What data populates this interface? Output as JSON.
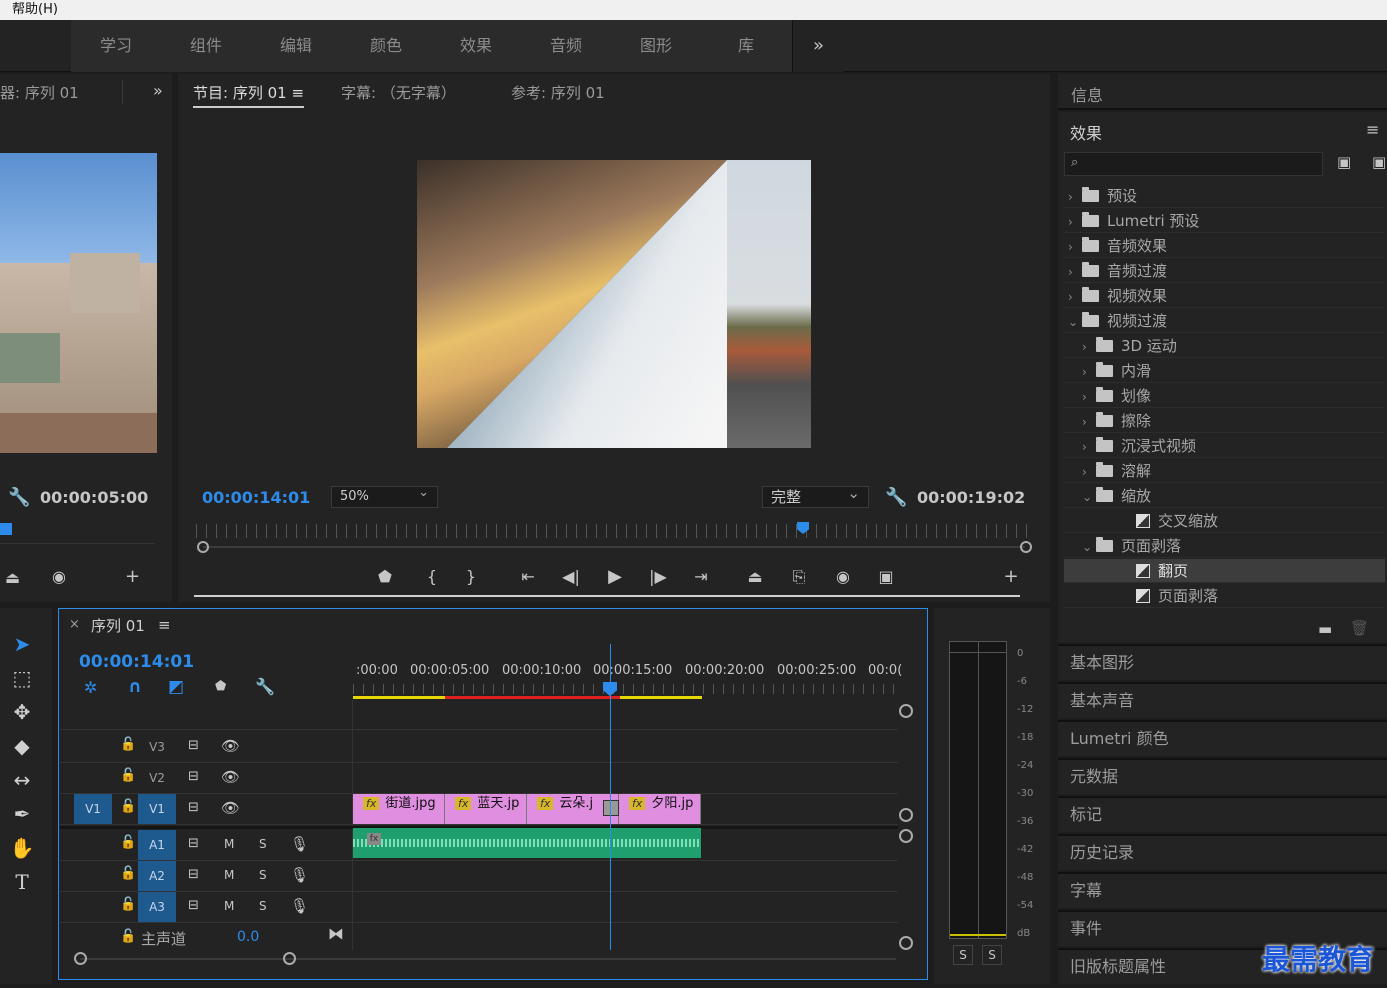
{
  "menu": {
    "help": "帮助(H)"
  },
  "workspaces": [
    "学习",
    "组件",
    "编辑",
    "颜色",
    "效果",
    "音频",
    "图形",
    "库"
  ],
  "workspaces_more": "»",
  "source_monitor": {
    "tab": "器: 序列 01",
    "more": "»",
    "timecode": "00:00:05:00"
  },
  "program_monitor": {
    "tabs": [
      "节目: 序列 01",
      "字幕: （无字幕）",
      "参考: 序列 01"
    ],
    "menu_icon": "≡",
    "timecode": "00:00:14:01",
    "zoom": "50%",
    "quality": "完整",
    "duration": "00:00:19:02",
    "playhead_fraction": 0.73
  },
  "effects_panel": {
    "info_tab": "信息",
    "title": "效果",
    "menu_icon": "≡",
    "search_placeholder": "",
    "tree": [
      {
        "label": "预设",
        "depth": 0,
        "state": "collapsed",
        "kind": "preset"
      },
      {
        "label": "Lumetri 预设",
        "depth": 0,
        "state": "collapsed",
        "kind": "preset"
      },
      {
        "label": "音频效果",
        "depth": 0,
        "state": "collapsed",
        "kind": "folder"
      },
      {
        "label": "音频过渡",
        "depth": 0,
        "state": "collapsed",
        "kind": "folder"
      },
      {
        "label": "视频效果",
        "depth": 0,
        "state": "collapsed",
        "kind": "folder"
      },
      {
        "label": "视频过渡",
        "depth": 0,
        "state": "expanded",
        "kind": "folder"
      },
      {
        "label": "3D 运动",
        "depth": 1,
        "state": "collapsed",
        "kind": "folder"
      },
      {
        "label": "内滑",
        "depth": 1,
        "state": "collapsed",
        "kind": "folder"
      },
      {
        "label": "划像",
        "depth": 1,
        "state": "collapsed",
        "kind": "folder"
      },
      {
        "label": "擦除",
        "depth": 1,
        "state": "collapsed",
        "kind": "folder"
      },
      {
        "label": "沉浸式视频",
        "depth": 1,
        "state": "collapsed",
        "kind": "folder"
      },
      {
        "label": "溶解",
        "depth": 1,
        "state": "collapsed",
        "kind": "folder"
      },
      {
        "label": "缩放",
        "depth": 1,
        "state": "expanded",
        "kind": "folder"
      },
      {
        "label": "交叉缩放",
        "depth": 2,
        "state": "",
        "kind": "transition"
      },
      {
        "label": "页面剥落",
        "depth": 1,
        "state": "expanded",
        "kind": "folder"
      },
      {
        "label": "翻页",
        "depth": 2,
        "state": "selected",
        "kind": "transition"
      },
      {
        "label": "页面剥落",
        "depth": 2,
        "state": "",
        "kind": "transition"
      }
    ]
  },
  "side_panels": [
    "基本图形",
    "基本声音",
    "Lumetri 颜色",
    "元数据",
    "标记",
    "历史记录",
    "字幕",
    "事件",
    "旧版标题属性"
  ],
  "timeline": {
    "close": "×",
    "title": "序列 01",
    "menu_icon": "≡",
    "timecode": "00:00:14:01",
    "ruler_labels": [
      ":00:00",
      "00:00:05:00",
      "00:00:10:00",
      "00:00:15:00",
      "00:00:20:00",
      "00:00:25:00",
      "00:0("
    ],
    "video_tracks": [
      {
        "name": "V3",
        "source": ""
      },
      {
        "name": "V2",
        "source": ""
      },
      {
        "name": "V1",
        "source": "V1"
      }
    ],
    "audio_tracks": [
      {
        "name": "A1",
        "m": "M",
        "s": "S"
      },
      {
        "name": "A2",
        "m": "M",
        "s": "S"
      },
      {
        "name": "A3",
        "m": "M",
        "s": "S"
      }
    ],
    "master": {
      "label": "主声道",
      "value": "0.0"
    },
    "clips": [
      {
        "fx": "fx",
        "name": "街道.jpg"
      },
      {
        "fx": "fx",
        "name": "蓝天.jp"
      },
      {
        "fx": "fx",
        "name": "云朵.j"
      },
      {
        "fx": "fx",
        "name": "夕阳.jp"
      }
    ]
  },
  "audio_meter": {
    "scale": [
      "0",
      "-6",
      "-12",
      "-18",
      "-24",
      "-30",
      "-36",
      "-42",
      "-48",
      "-54",
      "dB"
    ],
    "solo": [
      "S",
      "S"
    ]
  },
  "watermark": "最需教育",
  "colors": {
    "accent": "#2d8ceb",
    "clip": "#e08ee0",
    "audio_clip": "#1f9e6e",
    "fx_badge": "#d8b82a",
    "playhead": "#2d8ceb"
  }
}
